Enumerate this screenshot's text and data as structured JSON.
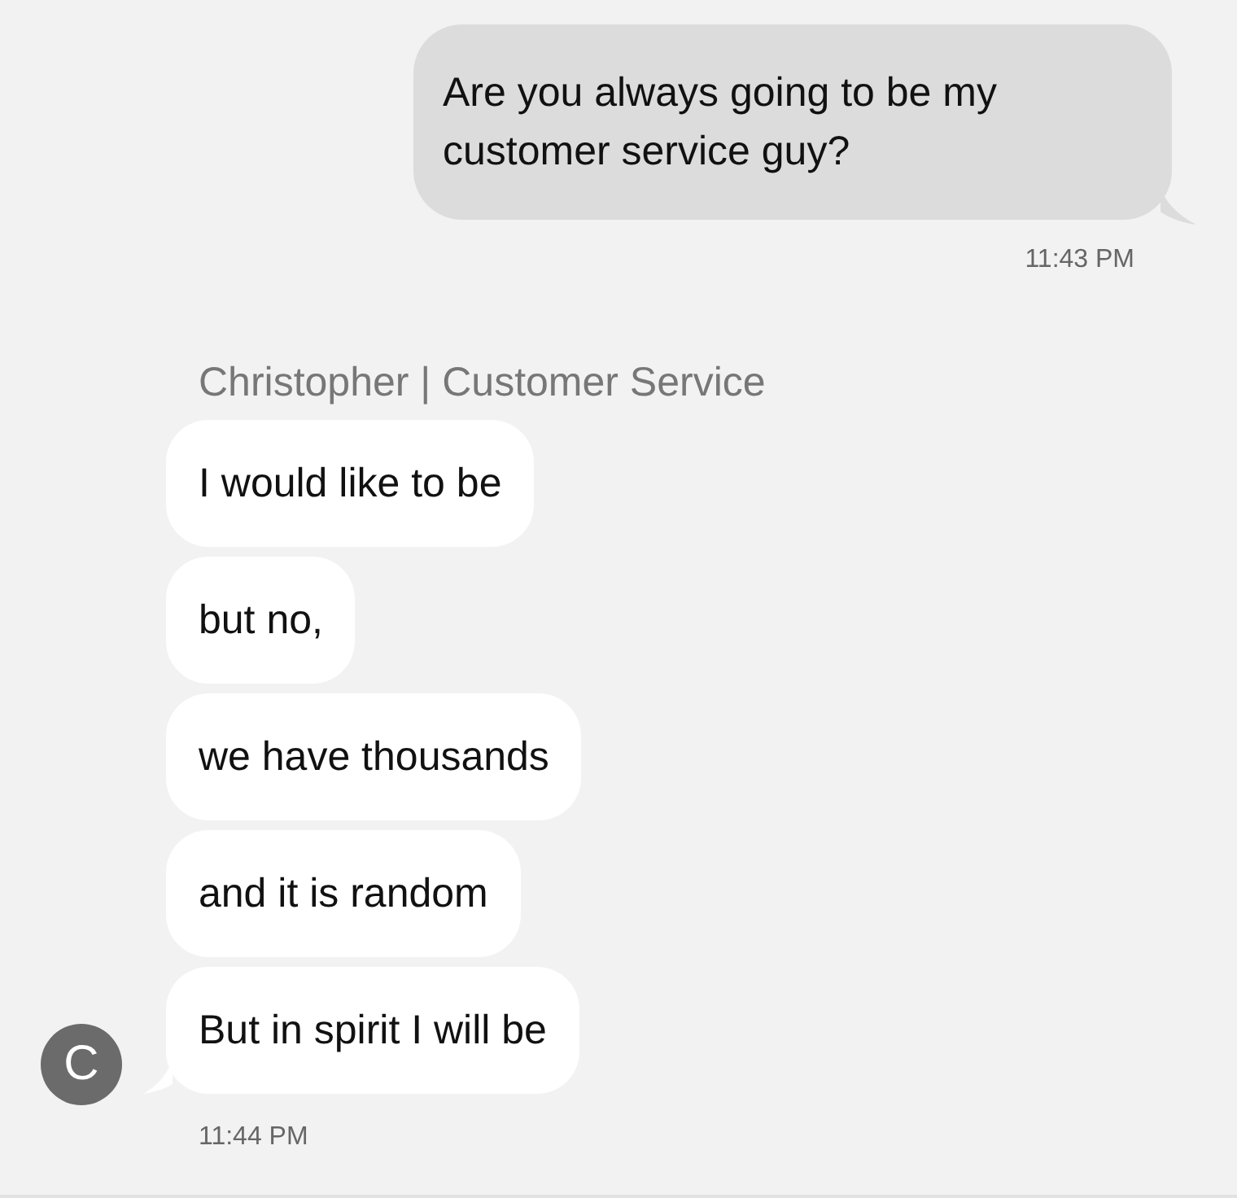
{
  "conversation": [
    {
      "kind": "outgoing",
      "bubbles": [
        "Are you always going to be my customer service guy?"
      ],
      "time": "11:43 PM"
    },
    {
      "kind": "incoming",
      "sender": "Christopher | Customer Service",
      "avatar": "C",
      "bubbles": [
        "I would like to be",
        "but no,",
        "we have thousands",
        "and it is random",
        "But in spirit I will be"
      ],
      "time": "11:44 PM"
    }
  ]
}
